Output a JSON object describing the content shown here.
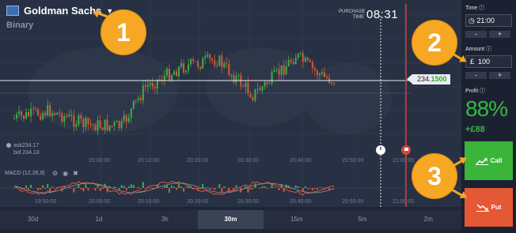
{
  "asset": {
    "name": "Goldman Sachs",
    "type": "Binary"
  },
  "purchase": {
    "label_1": "PURCHASE",
    "label_2": "TIME",
    "time": "08:31"
  },
  "price": {
    "prefix": "234.",
    "highlight": "1500"
  },
  "quote": {
    "ask": "ask234.17",
    "bid": "bid 234.13"
  },
  "time_ticks_main": [
    "20:00:00",
    "20:10:00",
    "20:20:00",
    "20:30:00",
    "20:40:00",
    "20:50:00",
    "21:00:00"
  ],
  "time_ticks_macd": [
    "19:50:00",
    "20:00:00",
    "20:10:00",
    "20:20:00",
    "20:30:00",
    "20:40:00",
    "20:50:00",
    "21:00:00"
  ],
  "macd": {
    "label": "MACD (12,26,9)"
  },
  "timeframes": [
    "30d",
    "1d",
    "3h",
    "30m",
    "15m",
    "5m",
    "2m"
  ],
  "active_timeframe": "30m",
  "panel": {
    "time_label": "Time",
    "time_value": "21:00",
    "amount_label": "Amount",
    "currency": "£",
    "amount_value": "100",
    "minus": "-",
    "plus": "+",
    "profit_label": "Profit",
    "profit_pct": "88%",
    "profit_amount": "+£88",
    "call_label": "Call",
    "put_label": "Put"
  },
  "badges": [
    "1",
    "2",
    "3"
  ],
  "colors": {
    "call": "#3bb43a",
    "put": "#e45835",
    "badge": "#f6a723",
    "profit": "#35b83f"
  }
}
